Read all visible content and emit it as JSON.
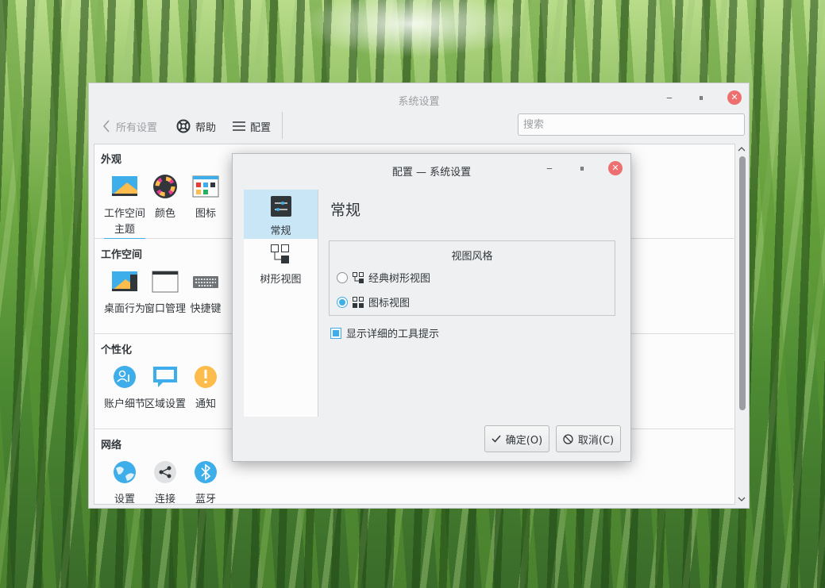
{
  "main_window": {
    "title": "系统设置",
    "toolbar": {
      "back_label": "所有设置",
      "help_label": "帮助",
      "config_label": "配置"
    },
    "search": {
      "placeholder": "搜索",
      "value": ""
    }
  },
  "sections": [
    {
      "title": "外观",
      "items": [
        {
          "label": "工作空间主题",
          "icon": "workspace-theme-icon"
        },
        {
          "label": "颜色",
          "icon": "colors-icon"
        },
        {
          "label": "图标",
          "icon": "icons-icon"
        }
      ]
    },
    {
      "title": "工作空间",
      "items": [
        {
          "label": "桌面行为",
          "icon": "desktop-behavior-icon"
        },
        {
          "label": "窗口管理",
          "icon": "window-management-icon"
        },
        {
          "label": "快捷键",
          "icon": "keyboard-icon"
        }
      ]
    },
    {
      "title": "个性化",
      "items": [
        {
          "label": "账户细节",
          "icon": "user-account-icon"
        },
        {
          "label": "区域设置",
          "icon": "regional-settings-icon"
        },
        {
          "label": "通知",
          "icon": "notification-icon"
        }
      ]
    },
    {
      "title": "网络",
      "items": [
        {
          "label": "设置",
          "icon": "globe-icon"
        },
        {
          "label": "连接",
          "icon": "share-icon"
        },
        {
          "label": "蓝牙",
          "icon": "bluetooth-icon"
        }
      ]
    }
  ],
  "dialog": {
    "title": "配置 — 系统设置",
    "sidebar": [
      {
        "label": "常规",
        "selected": true
      },
      {
        "label": "树形视图",
        "selected": false
      }
    ],
    "page_title": "常规",
    "view_style": {
      "group_title": "视图风格",
      "options": [
        {
          "label": "经典树形视图",
          "checked": false
        },
        {
          "label": "图标视图",
          "checked": true
        }
      ]
    },
    "detailed_tooltips": {
      "label": "显示详细的工具提示",
      "checked": true
    },
    "ok_label": "确定(O)",
    "cancel_label": "取消(C)"
  },
  "colors": {
    "accent": "#3daee9",
    "close_button": "#ed6f70"
  }
}
